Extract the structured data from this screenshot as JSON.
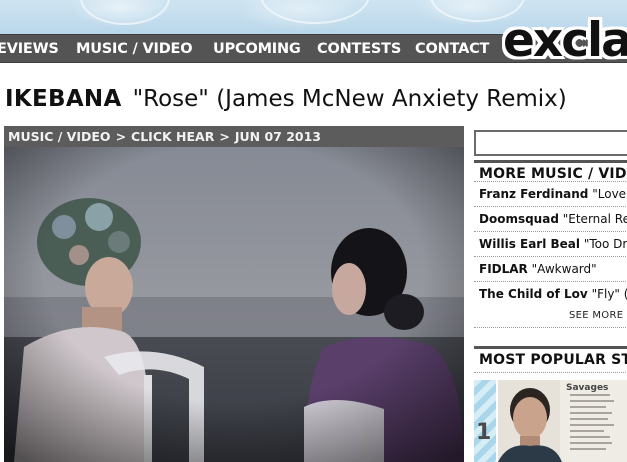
{
  "nav": {
    "items": [
      "EVIEWS",
      "MUSIC / VIDEO",
      "UPCOMING",
      "CONTESTS",
      "CONTACT"
    ],
    "logo": "excla"
  },
  "article": {
    "artist": "IKEBANA",
    "song": "\"Rose\" (James McNew Anxiety Remix)",
    "breadcrumb": [
      "MUSIC / VIDEO",
      "CLICK HEAR",
      "JUN 07 2013"
    ]
  },
  "sidebar": {
    "more_heading": "MORE MUSIC / VIDEO",
    "items": [
      {
        "artist": "Franz Ferdinand",
        "title": "\"Love Ill"
      },
      {
        "artist": "Doomsquad",
        "title": "\"Eternal Retu"
      },
      {
        "artist": "Willis Earl Beal",
        "title": "\"Too Dry"
      },
      {
        "artist": "FIDLAR",
        "title": "\"Awkward\""
      },
      {
        "artist": "The Child of Lov",
        "title": "\"Fly\" (vi"
      }
    ],
    "see_more": "SEE MORE M",
    "popular_heading": "MOST POPULAR STO",
    "popular": [
      {
        "rank": "1",
        "caption": "Savages"
      }
    ]
  }
}
